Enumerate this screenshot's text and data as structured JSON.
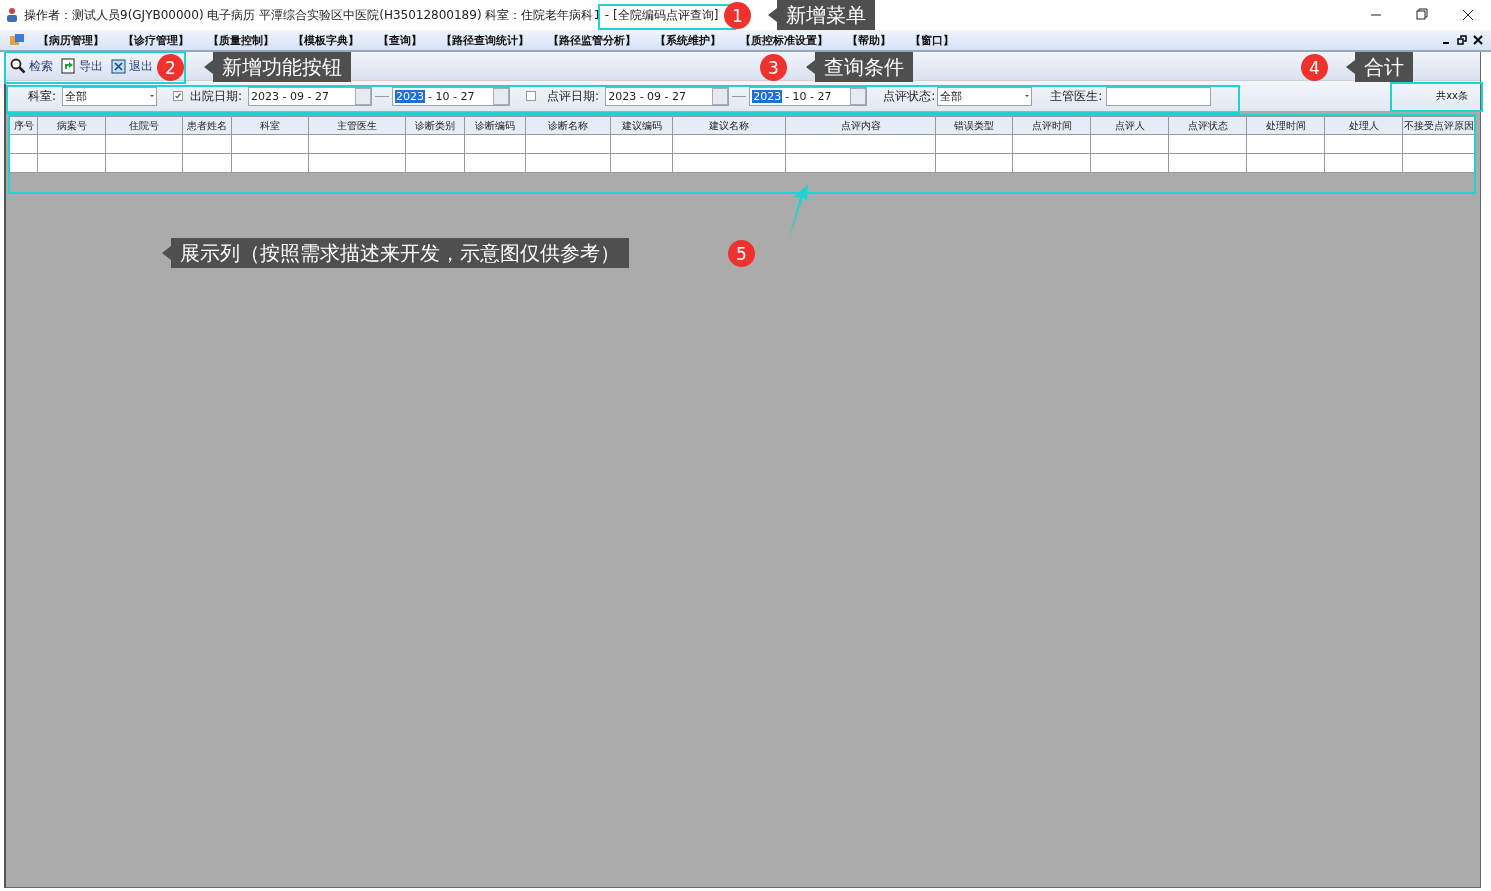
{
  "window": {
    "title": "操作者：测试人员9(GJYB00000) 电子病历  平潭综合实验区中医院(H35012800189)  科室：住院老年病科1 - [全院编码点评查询]"
  },
  "menu": [
    "【病历管理】",
    "【诊疗管理】",
    "【质量控制】",
    "【模板字典】",
    "【查询】",
    "【路径查询统计】",
    "【路径监管分析】",
    "【系统维护】",
    "【质控标准设置】",
    "【帮助】",
    "【窗口】"
  ],
  "toolbar": [
    {
      "kind": "search",
      "label": "检索"
    },
    {
      "kind": "export",
      "label": "导出"
    },
    {
      "kind": "exit",
      "label": "退出"
    }
  ],
  "filters": {
    "department": {
      "label": "科室:",
      "value": "全部"
    },
    "discharge_date": {
      "label": "出院日期:",
      "checked": true,
      "from": "2023 - 09 - 27",
      "to_year": "2023",
      "to_rest": "- 10 - 27"
    },
    "review_date": {
      "label": "点评日期:",
      "checked": false,
      "from": "2023 - 09 - 27",
      "to_year": "2023",
      "to_rest": "- 10 - 27"
    },
    "review_status": {
      "label": "点评状态:",
      "value": "全部"
    },
    "doctor": {
      "label": "主管医生:"
    },
    "total": "共xx条"
  },
  "table": {
    "columns": [
      "序号",
      "病案号",
      "住院号",
      "患者姓名",
      "科室",
      "主管医生",
      "诊断类别",
      "诊断编码",
      "诊断名称",
      "建议编码",
      "建议名称",
      "点评内容",
      "错误类型",
      "点评时间",
      "点评人",
      "点评状态",
      "处理时间",
      "处理人",
      "不接受点评原因"
    ]
  },
  "annotations": [
    {
      "number": "1",
      "label": "新增菜单"
    },
    {
      "number": "2",
      "label": "新增功能按钮"
    },
    {
      "number": "3",
      "label": "查询条件"
    },
    {
      "number": "4",
      "label": "合计"
    },
    {
      "number": "5",
      "label": "展示列（按照需求描述来开发，示意图仅供参考）"
    }
  ]
}
